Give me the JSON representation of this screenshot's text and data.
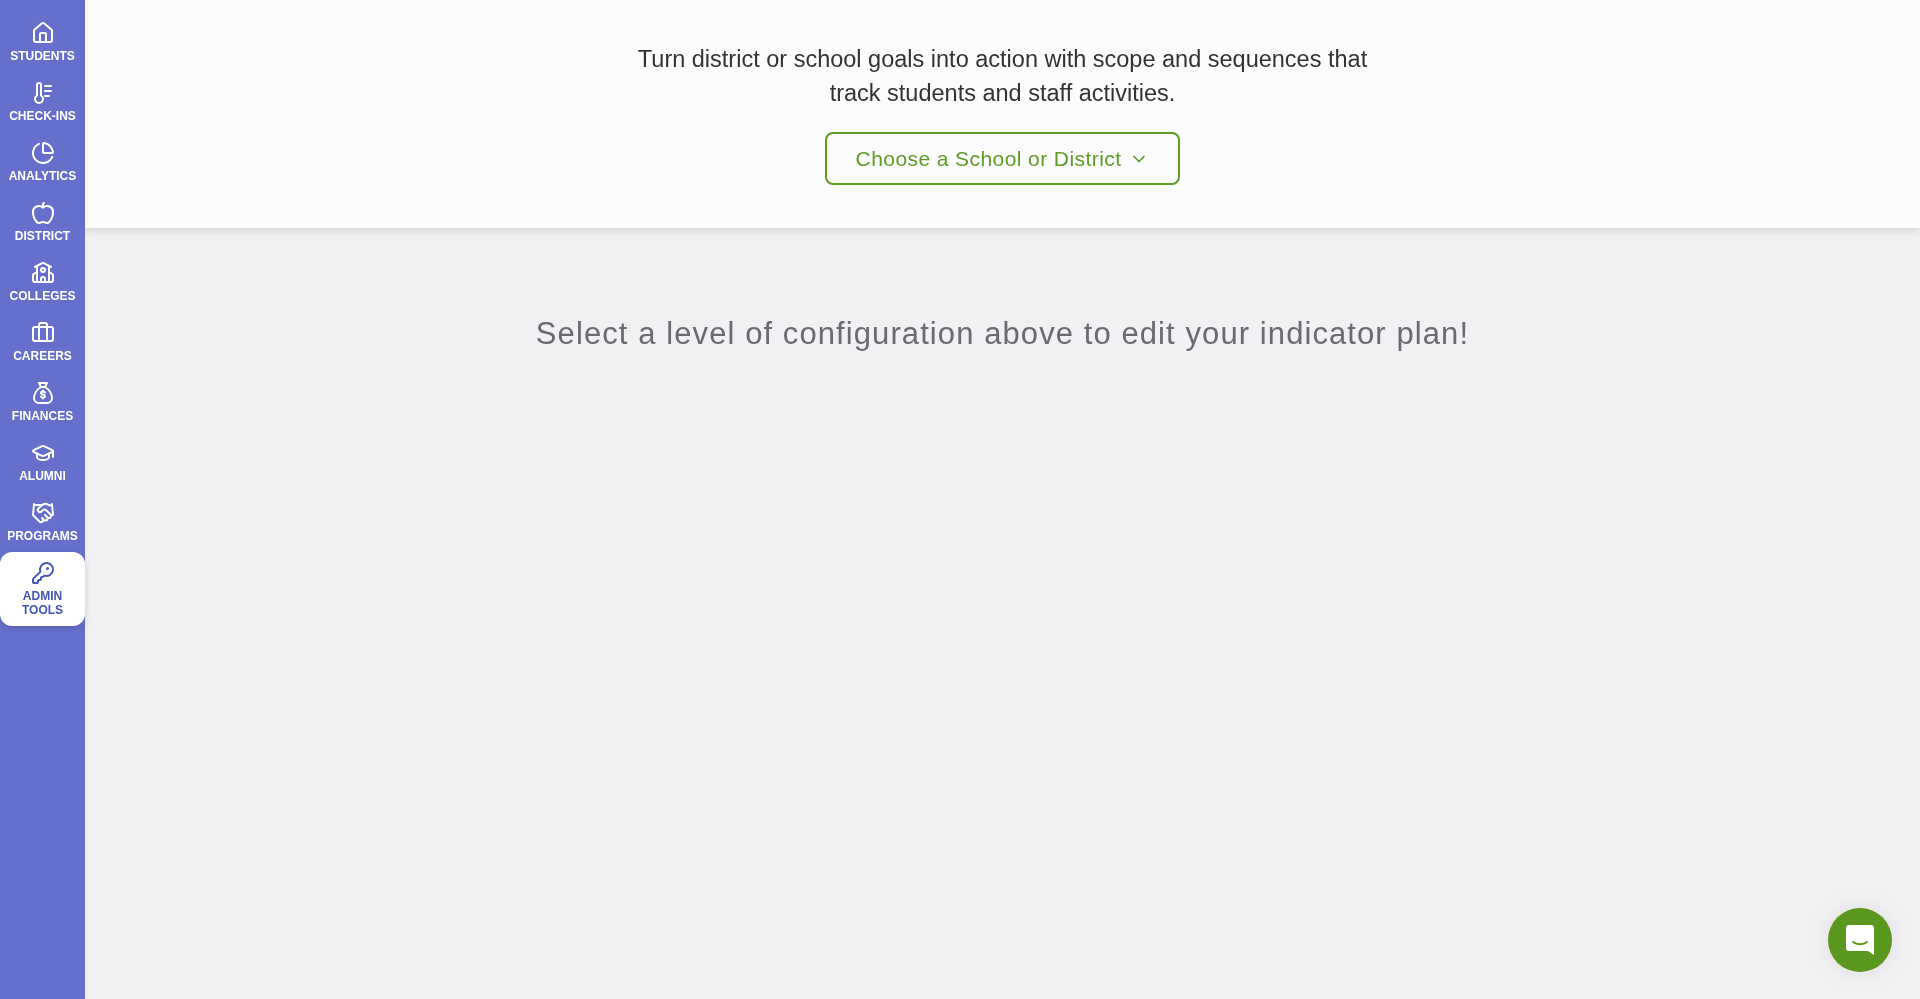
{
  "sidebar": {
    "items": [
      {
        "label": "STUDENTS",
        "selected": false
      },
      {
        "label": "CHECK-INS",
        "selected": false
      },
      {
        "label": "ANALYTICS",
        "selected": false
      },
      {
        "label": "DISTRICT",
        "selected": false
      },
      {
        "label": "COLLEGES",
        "selected": false
      },
      {
        "label": "CAREERS",
        "selected": false
      },
      {
        "label": "FINANCES",
        "selected": false
      },
      {
        "label": "ALUMNI",
        "selected": false
      },
      {
        "label": "PROGRAMS",
        "selected": false
      },
      {
        "label": "ADMIN TOOLS",
        "selected": true
      }
    ]
  },
  "header": {
    "description": "Turn district or school goals into action with scope and sequences that track students and staff activities.",
    "selector": {
      "label": "Choose a School or District"
    }
  },
  "message": "Select a level of configuration above to edit your indicator plan!"
}
